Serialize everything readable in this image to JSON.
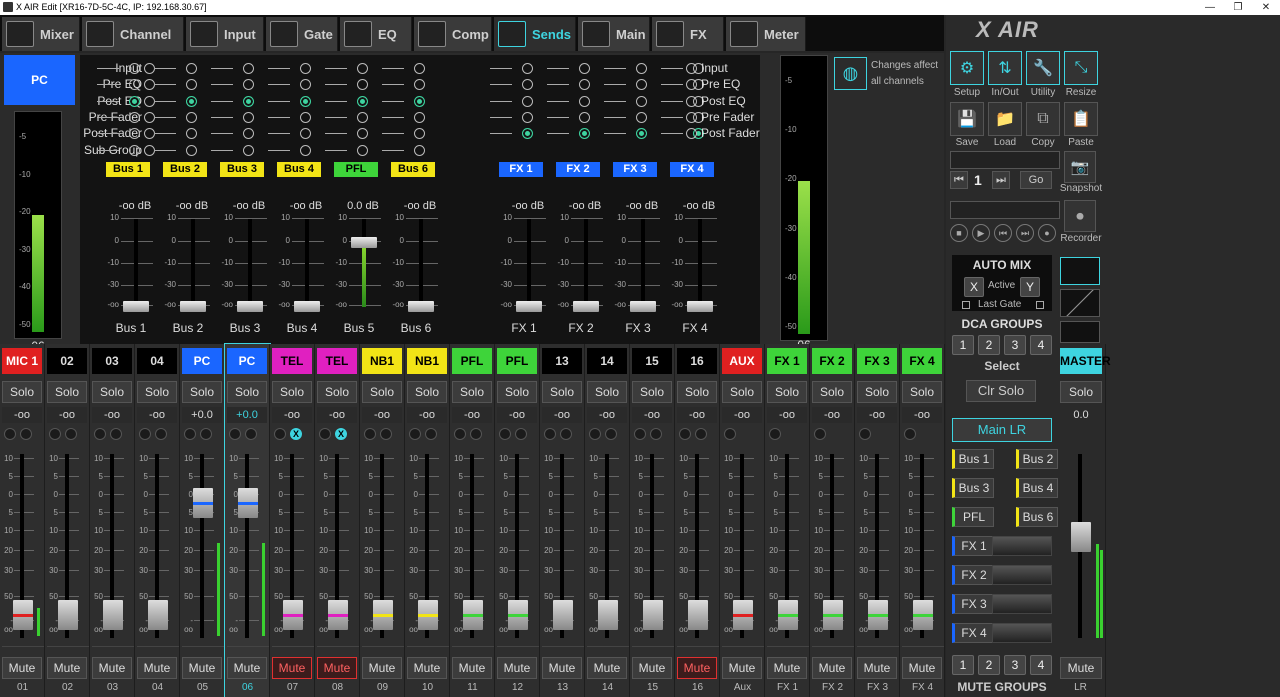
{
  "window": {
    "title": "X AIR Edit [XR16-7D-5C-4C, IP: 192.168.30.67]",
    "minimize": "—",
    "maximize": "❐",
    "close": "✕"
  },
  "tabs": [
    {
      "label": "Mixer",
      "icon": "mixer-icon"
    },
    {
      "label": "Channel",
      "icon": "channel-icon"
    },
    {
      "label": "Input",
      "icon": "input-icon"
    },
    {
      "label": "Gate",
      "icon": "gate-icon"
    },
    {
      "label": "EQ",
      "icon": "eq-icon"
    },
    {
      "label": "Comp",
      "icon": "comp-icon"
    },
    {
      "label": "Sends",
      "icon": "sends-icon",
      "active": true
    },
    {
      "label": "Main",
      "icon": "main-icon"
    },
    {
      "label": "FX",
      "icon": "fx-icon"
    },
    {
      "label": "Meter",
      "icon": "meter-icon"
    }
  ],
  "sends": {
    "channel_label": "PC",
    "channel_meter_label": "06",
    "channel_meter_level": 0.62,
    "right_meter_label": "06",
    "right_meter_level": 0.62,
    "meter_scale": [
      "-5",
      "-10",
      "-20",
      "-30",
      "-40",
      "-50"
    ],
    "tap_options": [
      "Input",
      "Pre EQ",
      "Post EQ",
      "Pre Fader",
      "Post Fader",
      "Sub Group"
    ],
    "fx_tap_options": [
      "Input",
      "Pre EQ",
      "Post EQ",
      "Pre Fader",
      "Post Fader"
    ],
    "fader_scale": [
      "10",
      "0",
      "-10",
      "-30",
      "-oo"
    ],
    "buses": [
      {
        "label": "Bus 1",
        "color": "#f2e416",
        "db": "-oo dB",
        "name": "Bus 1",
        "tap": 2,
        "level": 0
      },
      {
        "label": "Bus 2",
        "color": "#f2e416",
        "db": "-oo dB",
        "name": "Bus 2",
        "tap": 2,
        "level": 0
      },
      {
        "label": "Bus 3",
        "color": "#f2e416",
        "db": "-oo dB",
        "name": "Bus 3",
        "tap": 2,
        "level": 0
      },
      {
        "label": "Bus 4",
        "color": "#f2e416",
        "db": "-oo dB",
        "name": "Bus 4",
        "tap": 2,
        "level": 0
      },
      {
        "label": "PFL",
        "color": "#3ed43a",
        "db": "0.0 dB",
        "name": "Bus 5",
        "tap": 2,
        "level": 0.75
      },
      {
        "label": "Bus 6",
        "color": "#f2e416",
        "db": "-oo dB",
        "name": "Bus 6",
        "tap": 2,
        "level": 0
      }
    ],
    "fx": [
      {
        "label": "FX 1",
        "color": "#1a66ff",
        "db": "-oo dB",
        "name": "FX 1",
        "tap": 4,
        "level": 0
      },
      {
        "label": "FX 2",
        "color": "#1a66ff",
        "db": "-oo dB",
        "name": "FX 2",
        "tap": 4,
        "level": 0
      },
      {
        "label": "FX 3",
        "color": "#1a66ff",
        "db": "-oo dB",
        "name": "FX 3",
        "tap": 4,
        "level": 0
      },
      {
        "label": "FX 4",
        "color": "#1a66ff",
        "db": "-oo dB",
        "name": "FX 4",
        "tap": 4,
        "level": 0
      }
    ],
    "notice_line1": "Changes affect",
    "notice_line2": "all channels"
  },
  "right": {
    "logo": "X AIR",
    "tools": [
      {
        "label": "Setup",
        "icon": "gear-icon",
        "glyph": "⚙"
      },
      {
        "label": "In/Out",
        "icon": "in-out-icon",
        "glyph": "⇅"
      },
      {
        "label": "Utility",
        "icon": "wrench-icon",
        "glyph": "🔧"
      },
      {
        "label": "Resize",
        "icon": "resize-icon",
        "glyph": "⤡"
      }
    ],
    "files": [
      {
        "label": "Save",
        "icon": "save-icon",
        "glyph": "💾"
      },
      {
        "label": "Load",
        "icon": "folder-icon",
        "glyph": "📁"
      },
      {
        "label": "Copy",
        "icon": "copy-icon",
        "glyph": "⧉"
      },
      {
        "label": "Paste",
        "icon": "paste-icon",
        "glyph": "📋"
      }
    ],
    "snapshot_label": "Snapshot",
    "snapshot_number": "1",
    "go_label": "Go",
    "recorder_label": "Recorder",
    "automix": {
      "title": "AUTO MIX",
      "x": "X",
      "active": "Active",
      "y": "Y",
      "last_gate": "Last Gate"
    },
    "dca_title": "DCA GROUPS",
    "dca_buttons": [
      "1",
      "2",
      "3",
      "4"
    ],
    "select_label": "Select",
    "clr_solo": "Clr Solo",
    "main_lr": "Main LR",
    "bus_sends": [
      {
        "label": "Bus 1",
        "color": "#f2e416"
      },
      {
        "label": "Bus 2",
        "color": "#f2e416"
      },
      {
        "label": "Bus 3",
        "color": "#f2e416"
      },
      {
        "label": "Bus 4",
        "color": "#f2e416"
      },
      {
        "label": "PFL",
        "color": "#3ed43a"
      },
      {
        "label": "Bus 6",
        "color": "#f2e416"
      },
      {
        "label": "FX 1",
        "color": "#1a66ff"
      },
      {
        "label": "FX 2",
        "color": "#1a66ff"
      },
      {
        "label": "FX 3",
        "color": "#1a66ff"
      },
      {
        "label": "FX 4",
        "color": "#1a66ff"
      }
    ],
    "mute_groups_title": "MUTE GROUPS",
    "mute_group_buttons": [
      "1",
      "2",
      "3",
      "4"
    ],
    "master": {
      "name": "MASTER",
      "solo": "Solo",
      "gain": "0.0",
      "mute": "Mute",
      "num": "LR",
      "level": 0.55,
      "meter": 0.5
    }
  },
  "strips": [
    {
      "name": "MIC 1",
      "color": "#e02020",
      "fg": "#fff",
      "gain": "-oo",
      "num": "01",
      "level": 0,
      "meter": 0.15,
      "capcolor": "#e02020",
      "mute": false,
      "x": [
        false,
        false
      ]
    },
    {
      "name": "02",
      "color": "#000",
      "fg": "#ddd",
      "gain": "-oo",
      "num": "02",
      "level": 0,
      "meter": 0,
      "capcolor": "",
      "mute": false,
      "x": [
        false,
        false
      ]
    },
    {
      "name": "03",
      "color": "#000",
      "fg": "#ddd",
      "gain": "-oo",
      "num": "03",
      "level": 0,
      "meter": 0,
      "capcolor": "",
      "mute": false,
      "x": [
        false,
        false
      ]
    },
    {
      "name": "04",
      "color": "#000",
      "fg": "#ddd",
      "gain": "-oo",
      "num": "04",
      "level": 0,
      "meter": 0,
      "capcolor": "",
      "mute": false,
      "x": [
        false,
        false
      ]
    },
    {
      "name": "PC",
      "color": "#1a66ff",
      "fg": "#fff",
      "gain": "+0.0",
      "num": "05",
      "level": 0.75,
      "meter": 0.5,
      "capcolor": "#1a66ff",
      "mute": false,
      "x": [
        false,
        false
      ]
    },
    {
      "name": "PC",
      "color": "#1a66ff",
      "fg": "#fff",
      "gain": "+0.0",
      "num": "06",
      "level": 0.75,
      "meter": 0.5,
      "capcolor": "#1a66ff",
      "mute": false,
      "x": [
        false,
        false
      ],
      "selected": true
    },
    {
      "name": "TEL",
      "color": "#e020c0",
      "fg": "#000",
      "gain": "-oo",
      "num": "07",
      "level": 0,
      "meter": 0,
      "capcolor": "#e020c0",
      "mute": true,
      "x": [
        false,
        true
      ]
    },
    {
      "name": "TEL",
      "color": "#e020c0",
      "fg": "#000",
      "gain": "-oo",
      "num": "08",
      "level": 0,
      "meter": 0,
      "capcolor": "#e020c0",
      "mute": true,
      "x": [
        false,
        true
      ]
    },
    {
      "name": "NB1",
      "color": "#f2e416",
      "fg": "#000",
      "gain": "-oo",
      "num": "09",
      "level": 0,
      "meter": 0,
      "capcolor": "#f2e416",
      "mute": false,
      "x": [
        false,
        false
      ]
    },
    {
      "name": "NB1",
      "color": "#f2e416",
      "fg": "#000",
      "gain": "-oo",
      "num": "10",
      "level": 0,
      "meter": 0,
      "capcolor": "#f2e416",
      "mute": false,
      "x": [
        false,
        false
      ]
    },
    {
      "name": "PFL",
      "color": "#3ed43a",
      "fg": "#000",
      "gain": "-oo",
      "num": "11",
      "level": 0,
      "meter": 0,
      "capcolor": "#3ed43a",
      "mute": false,
      "x": [
        false,
        false
      ]
    },
    {
      "name": "PFL",
      "color": "#3ed43a",
      "fg": "#000",
      "gain": "-oo",
      "num": "12",
      "level": 0,
      "meter": 0,
      "capcolor": "#3ed43a",
      "mute": false,
      "x": [
        false,
        false
      ]
    },
    {
      "name": "13",
      "color": "#000",
      "fg": "#ddd",
      "gain": "-oo",
      "num": "13",
      "level": 0,
      "meter": 0,
      "capcolor": "",
      "mute": false,
      "x": [
        false,
        false
      ]
    },
    {
      "name": "14",
      "color": "#000",
      "fg": "#ddd",
      "gain": "-oo",
      "num": "14",
      "level": 0,
      "meter": 0,
      "capcolor": "",
      "mute": false,
      "x": [
        false,
        false
      ]
    },
    {
      "name": "15",
      "color": "#000",
      "fg": "#ddd",
      "gain": "-oo",
      "num": "15",
      "level": 0,
      "meter": 0,
      "capcolor": "",
      "mute": false,
      "x": [
        false,
        false
      ]
    },
    {
      "name": "16",
      "color": "#000",
      "fg": "#ddd",
      "gain": "-oo",
      "num": "16",
      "level": 0,
      "meter": 0,
      "capcolor": "",
      "mute": true,
      "x": [
        false,
        false
      ]
    },
    {
      "name": "AUX IN",
      "color": "#e02020",
      "fg": "#fff",
      "gain": "-oo",
      "num": "Aux",
      "level": 0,
      "meter": 0,
      "capcolor": "#e02020",
      "mute": false,
      "x": [
        false,
        false
      ],
      "single": true
    },
    {
      "name": "FX 1",
      "color": "#3ed43a",
      "fg": "#000",
      "gain": "-oo",
      "num": "FX 1",
      "level": 0,
      "meter": 0,
      "capcolor": "#3ed43a",
      "mute": false,
      "x": [
        false,
        false
      ],
      "single": true
    },
    {
      "name": "FX 2",
      "color": "#3ed43a",
      "fg": "#000",
      "gain": "-oo",
      "num": "FX 2",
      "level": 0,
      "meter": 0,
      "capcolor": "#3ed43a",
      "mute": false,
      "x": [
        false,
        false
      ],
      "single": true
    },
    {
      "name": "FX 3",
      "color": "#3ed43a",
      "fg": "#000",
      "gain": "-oo",
      "num": "FX 3",
      "level": 0,
      "meter": 0,
      "capcolor": "#3ed43a",
      "mute": false,
      "x": [
        false,
        false
      ],
      "single": true
    },
    {
      "name": "FX 4",
      "color": "#3ed43a",
      "fg": "#000",
      "gain": "-oo",
      "num": "FX 4",
      "level": 0,
      "meter": 0,
      "capcolor": "#3ed43a",
      "mute": false,
      "x": [
        false,
        false
      ],
      "single": true
    }
  ],
  "strip_labels": {
    "solo": "Solo",
    "mute": "Mute",
    "x_mark": "X"
  },
  "strip_scale": [
    "10",
    "5",
    "0",
    "5",
    "10",
    "20",
    "30",
    "50",
    "-oo"
  ]
}
